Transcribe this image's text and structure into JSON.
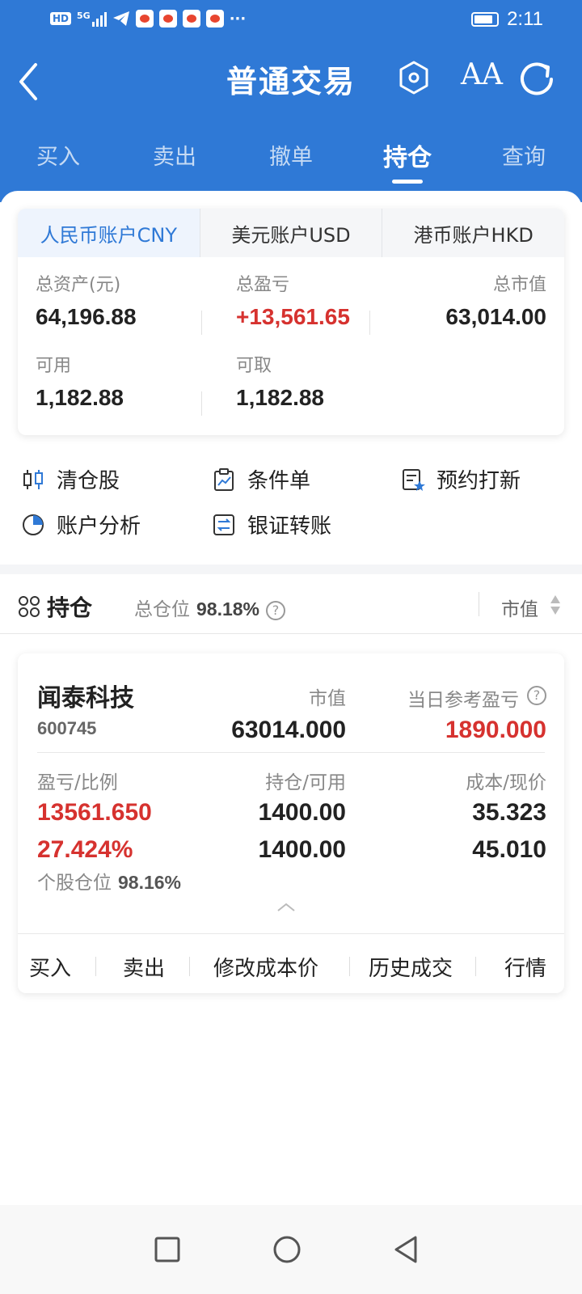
{
  "status_bar": {
    "network_badge": "HD",
    "signal_label": "5G",
    "time": "2:11",
    "more_dots": "···"
  },
  "header": {
    "title": "普通交易",
    "font_icon_label": "AA"
  },
  "tabs": [
    {
      "label": "买入",
      "active": false
    },
    {
      "label": "卖出",
      "active": false
    },
    {
      "label": "撤单",
      "active": false
    },
    {
      "label": "持仓",
      "active": true
    },
    {
      "label": "查询",
      "active": false
    }
  ],
  "account_tabs": [
    {
      "label": "人民币账户CNY",
      "active": true
    },
    {
      "label": "美元账户USD",
      "active": false
    },
    {
      "label": "港币账户HKD",
      "active": false
    }
  ],
  "account_summary": {
    "total_assets_label": "总资产(元)",
    "total_assets_value": "64,196.88",
    "total_pl_label": "总盈亏",
    "total_pl_value": "+13,561.65",
    "market_value_label": "总市值",
    "market_value_value": "63,014.00",
    "available_label": "可用",
    "available_value": "1,182.88",
    "withdrawable_label": "可取",
    "withdrawable_value": "1,182.88"
  },
  "functions": [
    {
      "label": "清仓股",
      "icon": "candlestick-icon"
    },
    {
      "label": "条件单",
      "icon": "clipboard-chart-icon"
    },
    {
      "label": "预约打新",
      "icon": "list-star-icon"
    },
    {
      "label": "账户分析",
      "icon": "pie-chart-icon"
    },
    {
      "label": "银证转账",
      "icon": "transfer-icon"
    }
  ],
  "holdings_bar": {
    "title": "持仓",
    "position_label": "总仓位",
    "position_value": "98.18%",
    "help_glyph": "?",
    "sort_label": "市值"
  },
  "stock": {
    "name": "闻泰科技",
    "code": "600745",
    "market_value_label": "市值",
    "market_value": "63014.000",
    "daily_pl_label": "当日参考盈亏",
    "daily_pl": "1890.000",
    "pl_ratio_label": "盈亏/比例",
    "pl_value": "13561.650",
    "pl_ratio": "27.424%",
    "holding_label": "持仓/可用",
    "holding": "1400.00",
    "available": "1400.00",
    "cost_label": "成本/现价",
    "cost": "35.323",
    "price": "45.010",
    "stock_position_label": "个股仓位",
    "stock_position_value": "98.16%"
  },
  "stock_actions": [
    {
      "label": "买入"
    },
    {
      "label": "卖出"
    },
    {
      "label": "修改成本价"
    },
    {
      "label": "历史成交"
    },
    {
      "label": "行情"
    }
  ],
  "colors": {
    "primary": "#2f79d6",
    "profit_red": "#d6322f"
  }
}
